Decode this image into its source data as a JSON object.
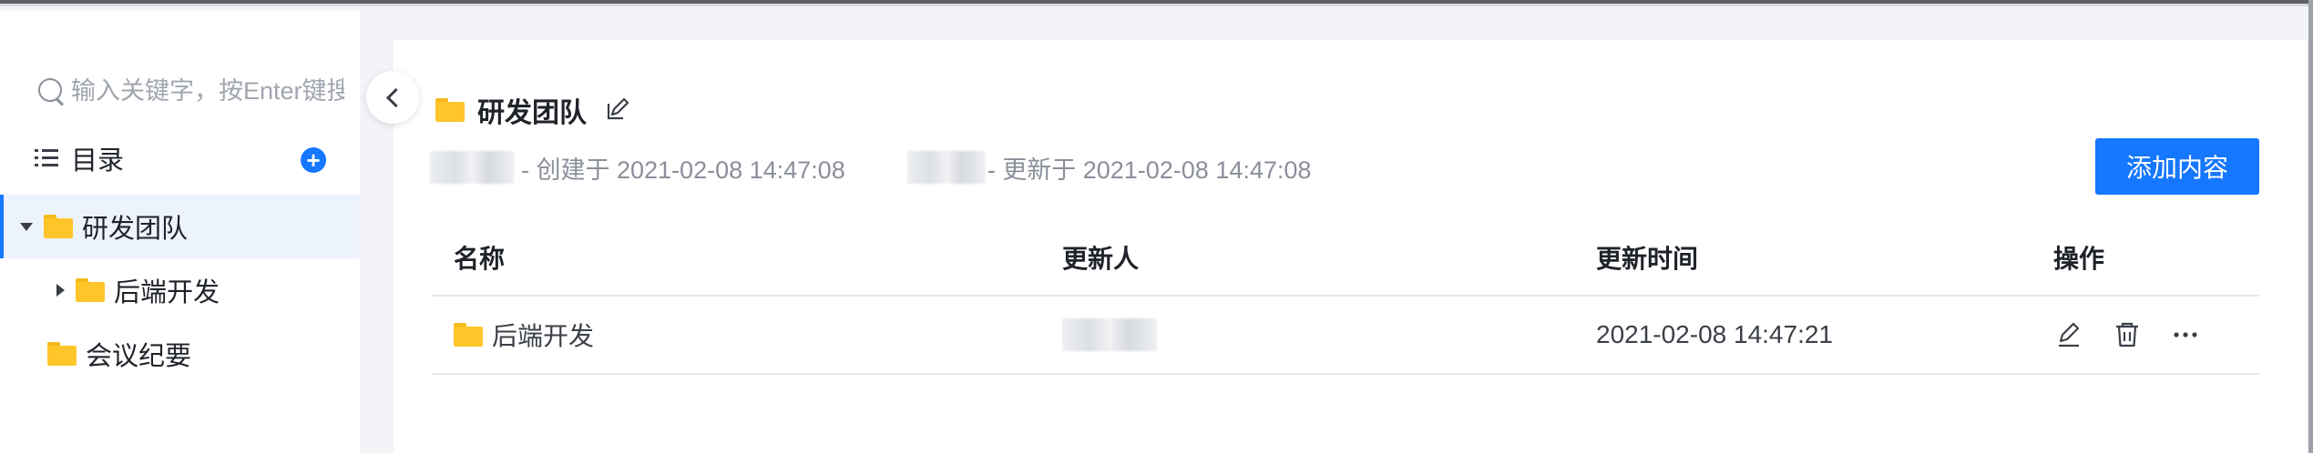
{
  "sidebar": {
    "search_placeholder": "输入关键字，按Enter键搜索",
    "catalog_label": "目录",
    "add_icon_glyph": "+",
    "tree": [
      {
        "label": "研发团队",
        "expanded": true,
        "active": true,
        "level": 0
      },
      {
        "label": "后端开发",
        "expanded": false,
        "active": false,
        "level": 1
      },
      {
        "label": "会议纪要",
        "expanded": false,
        "active": false,
        "level": 0
      }
    ]
  },
  "main": {
    "title": "研发团队",
    "created_text": "- 创建于 2021-02-08 14:47:08",
    "updated_text": "- 更新于 2021-02-08 14:47:08",
    "add_button": "添加内容",
    "table": {
      "headers": {
        "name": "名称",
        "updater": "更新人",
        "updated_time": "更新时间",
        "actions": "操作"
      },
      "rows": [
        {
          "name": "后端开发",
          "updater": "",
          "updated_time": "2021-02-08 14:47:21"
        }
      ]
    }
  },
  "colors": {
    "accent": "#1677ff",
    "folder": "#ffc62b",
    "active_bg": "#edf3fd"
  }
}
